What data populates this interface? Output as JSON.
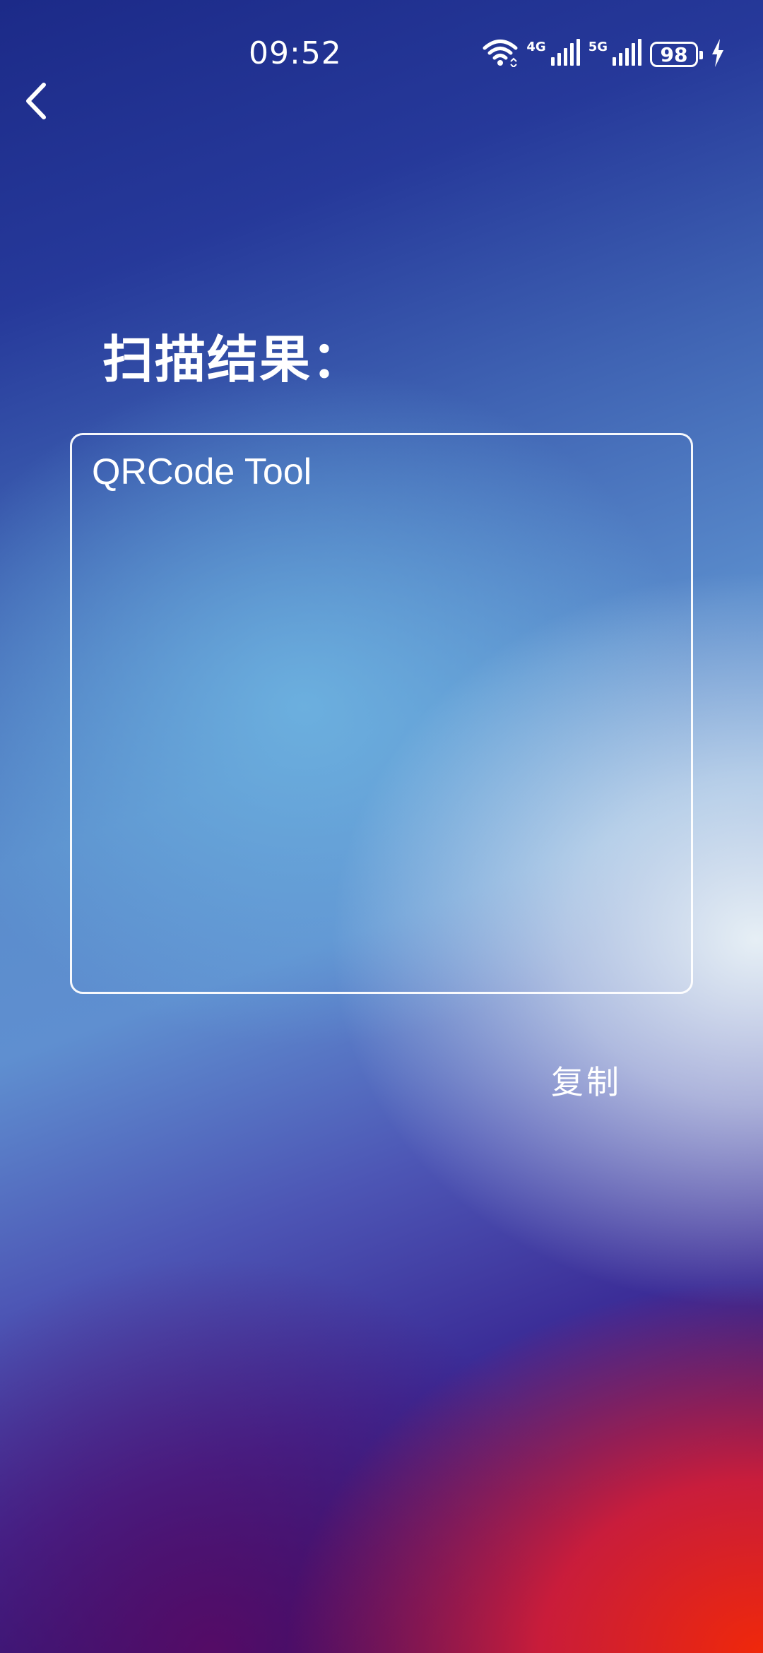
{
  "status_bar": {
    "time": "09:52",
    "network_1": "4G",
    "network_2": "5G",
    "battery": "98",
    "icons": [
      "wifi-icon",
      "signal-icon",
      "signal-icon",
      "battery-icon",
      "charging-icon"
    ]
  },
  "header": {
    "back_icon": "chevron-left-icon"
  },
  "main": {
    "title": "扫描结果：",
    "result_text": "QRCode Tool",
    "copy_label": "复制"
  },
  "colors": {
    "text": "#ffffff",
    "background_top": "#1c2a88",
    "background_bottom_right": "#f0280a"
  }
}
